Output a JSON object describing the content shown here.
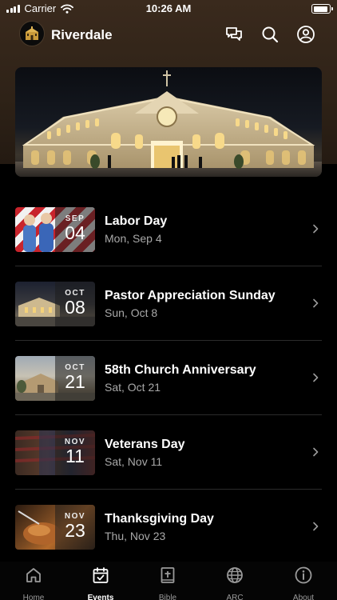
{
  "status_bar": {
    "carrier": "Carrier",
    "time": "10:26 AM",
    "battery_level": 0.95
  },
  "header": {
    "title": "Riverdale",
    "icons": [
      "logo-church-icon",
      "chat-icon",
      "search-icon",
      "account-icon"
    ]
  },
  "hero": {
    "image": "church-building-night"
  },
  "events": [
    {
      "month": "SEP",
      "day": "04",
      "title": "Labor Day",
      "date": "Mon, Sep 4",
      "thumb": "flag-workers"
    },
    {
      "month": "OCT",
      "day": "08",
      "title": "Pastor Appreciation Sunday",
      "date": "Sun, Oct 8",
      "thumb": "church-dusk"
    },
    {
      "month": "OCT",
      "day": "21",
      "title": "58th Church Anniversary",
      "date": "Sat, Oct 21",
      "thumb": "church-day"
    },
    {
      "month": "NOV",
      "day": "11",
      "title": "Veterans Day",
      "date": "Sat, Nov 11",
      "thumb": "flag-soldier"
    },
    {
      "month": "NOV",
      "day": "23",
      "title": "Thanksgiving Day",
      "date": "Thu, Nov 23",
      "thumb": "turkey-dinner"
    }
  ],
  "tabs": [
    {
      "label": "Home",
      "icon": "home-icon",
      "active": false
    },
    {
      "label": "Events",
      "icon": "calendar-check-icon",
      "active": true
    },
    {
      "label": "Bible",
      "icon": "bible-icon",
      "active": false
    },
    {
      "label": "ARC",
      "icon": "globe-icon",
      "active": false
    },
    {
      "label": "About",
      "icon": "info-icon",
      "active": false
    }
  ],
  "colors": {
    "header_bg": "#3a2a1d",
    "page_bg": "#000000",
    "text_primary": "#ffffff",
    "text_secondary": "#a9a9a9",
    "tab_inactive": "#9a9a9a"
  }
}
